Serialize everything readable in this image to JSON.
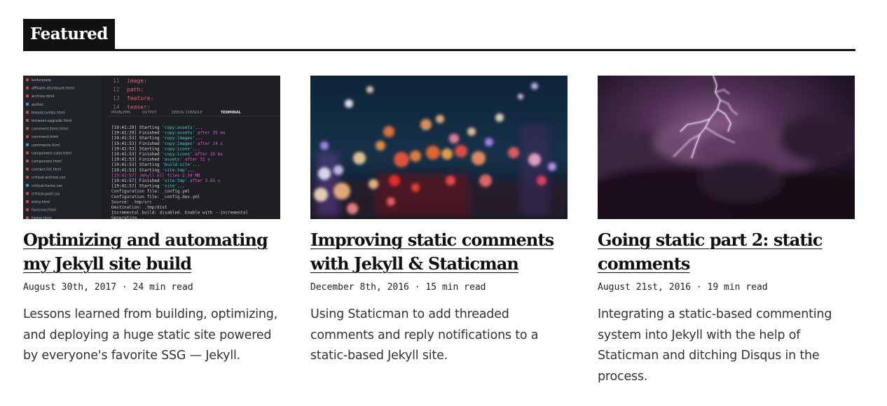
{
  "section": {
    "title": "Featured"
  },
  "posts": [
    {
      "title": "Optimizing and automating my Jekyll site build",
      "date": "August 30th, 2017",
      "separator": "·",
      "read_time": "24 min read",
      "excerpt": "Lessons learned from building, optimizing, and deploying a huge static site powered by everyone's favorite SSG — Jekyll.",
      "image": "code-editor-terminal-screenshot",
      "terminal": {
        "files": [
          "boilerplate",
          "affiliate-disclosure.html",
          "archive.html",
          "author",
          "breadcrumbs.html",
          "browser-upgrade.html",
          "comment-form.html",
          "comment.html",
          "comments.html",
          "component-color.html",
          "component.html",
          "contact-list.html",
          "critical-archive.css",
          "critical-home.css",
          "critical-post.css",
          "entry.html",
          "favicons.html",
          "footer.html"
        ],
        "code_lines": [
          {
            "num": "11",
            "text": "image:"
          },
          {
            "num": "12",
            "text": "  path:"
          },
          {
            "num": "13",
            "text": "  feature:"
          },
          {
            "num": "14",
            "text": "  teaser:"
          }
        ],
        "tabs": [
          "PROBLEMS",
          "OUTPUT",
          "DEBUG CONSOLE",
          "TERMINAL"
        ],
        "log": [
          "[19:41:29] Starting 'copy:assets'...",
          "[19:41:29] Finished 'copy:assets' after 35 ms",
          "[19:41:53] Starting 'copy:images'...",
          "[19:41:53] Finished 'copy:images' after 24 s",
          "[19:41:53] Starting 'copy:icons'...",
          "[19:41:53] Finished 'copy:icons' after 26 ms",
          "[19:41:53] Finished 'assets' after 31 s",
          "[19:41:53] Starting 'build:site'...",
          "[19:41:53] Starting 'site:tmp'...",
          "[19:41:57] Jekyll all files 2.34 MB",
          "[19:41:57] Finished 'site:tmp' after 3.65 s",
          "[19:41:57] Starting 'site'...",
          "Configuration file: _config.yml",
          "Configuration file: _config.dev.yml",
          "            Source: .tmp/src",
          "       Destination: .tmp/dist",
          " Incremental build: disabled. Enable with --incremental",
          "      Generating..."
        ]
      }
    },
    {
      "title": "Improving static comments with Jekyll & Staticman",
      "date": "December 8th, 2016",
      "separator": "·",
      "read_time": "15 min read",
      "excerpt": "Using Staticman to add threaded comments and reply notifications to a static-based Jekyll site.",
      "image": "city-lights-bokeh-photo"
    },
    {
      "title": "Going static part 2: static comments",
      "date": "August 21st, 2016",
      "separator": "·",
      "read_time": "19 min read",
      "excerpt": "Integrating a static-based commenting system into Jekyll with the help of Staticman and ditching Disqus in the process.",
      "image": "lightning-storm-photo"
    }
  ]
}
